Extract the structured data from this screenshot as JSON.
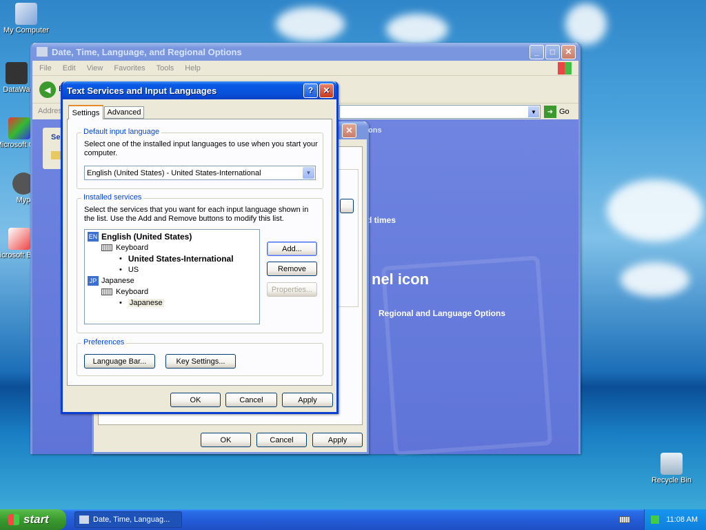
{
  "desktop": {
    "icons": [
      {
        "label": "My Computer"
      },
      {
        "label": "DataWa"
      },
      {
        "label": "Microsoft C++"
      },
      {
        "label": "Myp"
      },
      {
        "label": "Microsoft Basic"
      },
      {
        "label": "Recycle Bin"
      }
    ]
  },
  "main_window": {
    "title": "Date, Time, Language, and Regional Options",
    "menu": [
      "File",
      "Edit",
      "View",
      "Favorites",
      "Tools",
      "Help"
    ],
    "address_label": "Addres",
    "go_label": "Go",
    "back_label": "B",
    "sidebar_label": "Se",
    "panel_heading": "nel icon",
    "panel_text_times": "d times",
    "panel_link": "Regional and Language Options"
  },
  "regional_dialog": {
    "title_fragment": "ons",
    "ok": "OK",
    "cancel": "Cancel",
    "apply": "Apply"
  },
  "text_services_dialog": {
    "title": "Text Services and Input Languages",
    "tabs": [
      "Settings",
      "Advanced"
    ],
    "default_group": {
      "legend": "Default input language",
      "description": "Select one of the installed input languages to use when you start your computer.",
      "selected": "English (United States) - United States-International"
    },
    "installed_group": {
      "legend": "Installed services",
      "description": "Select the services that you want for each input language shown in the list. Use the Add and Remove buttons to modify this list.",
      "tree": {
        "lang1_code": "EN",
        "lang1": "English (United States)",
        "lang1_category": "Keyboard",
        "lang1_layout1": "United States-International",
        "lang1_layout2": "US",
        "lang2_code": "JP",
        "lang2": "Japanese",
        "lang2_category": "Keyboard",
        "lang2_layout1": "Japanese"
      },
      "add": "Add...",
      "remove": "Remove",
      "properties": "Properties..."
    },
    "preferences_group": {
      "legend": "Preferences",
      "language_bar": "Language Bar...",
      "key_settings": "Key Settings..."
    },
    "ok": "OK",
    "cancel": "Cancel",
    "apply": "Apply",
    "help_glyph": "?",
    "close_glyph": "✕"
  },
  "taskbar": {
    "start": "start",
    "task_item": "Date, Time, Languag...",
    "clock": "11:08 AM"
  }
}
